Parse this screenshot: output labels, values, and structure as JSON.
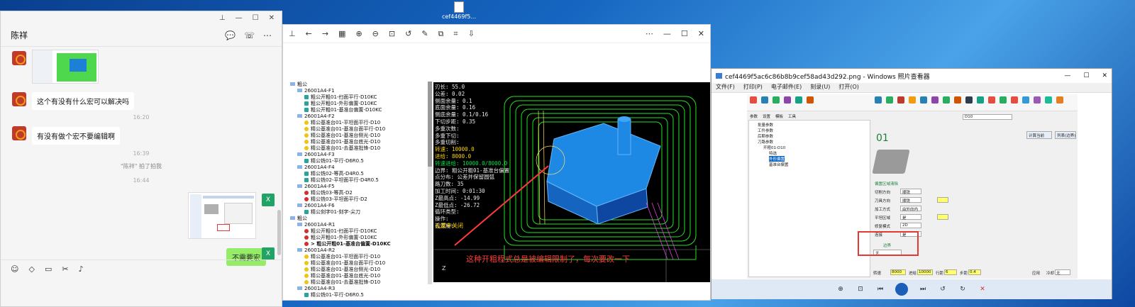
{
  "desktop": {
    "file_label": "cef4469f5..."
  },
  "chat": {
    "contact_name": "陈祥",
    "messages": [
      {
        "text": "这个有没有什么宏可以解决吗"
      },
      {
        "text": "有没有做个宏不要编辑啊"
      }
    ],
    "times": [
      "16:20",
      "16:39",
      "16:44"
    ],
    "system_note": "\"陈祥\" 拍了拍我",
    "reply": "不需要宏"
  },
  "viewer": {
    "tree": [
      {
        "text": "粗公",
        "lvl": 0,
        "kind": "fold"
      },
      {
        "text": "26001A4-F1",
        "lvl": 1,
        "kind": "fold"
      },
      {
        "text": "粗公开粗01-扫面平行-D10KC",
        "lvl": 2,
        "kind": "g"
      },
      {
        "text": "粗公开粗01-外形偏置-D10KC",
        "lvl": 2,
        "kind": "g"
      },
      {
        "text": "粗公开粗01-基准台偏置-D10KC",
        "lvl": 2,
        "kind": "g"
      },
      {
        "text": "26001A4-F2",
        "lvl": 1,
        "kind": "fold"
      },
      {
        "text": "精公基准台01-平坦面平行-D10",
        "lvl": 2,
        "kind": "y"
      },
      {
        "text": "精公基准台01-基准台面平行-D10",
        "lvl": 2,
        "kind": "y"
      },
      {
        "text": "精公基准台01-基准台侧光-D10",
        "lvl": 2,
        "kind": "y"
      },
      {
        "text": "精公基准台01-基准台底光-D10",
        "lvl": 2,
        "kind": "y"
      },
      {
        "text": "精公基准台01-去基准批锋-D10",
        "lvl": 2,
        "kind": "y"
      },
      {
        "text": "26001A4-F3",
        "lvl": 1,
        "kind": "fold"
      },
      {
        "text": "精公铣01-平行-D6R0.5",
        "lvl": 2,
        "kind": "g"
      },
      {
        "text": "26001A4-F4",
        "lvl": 1,
        "kind": "fold"
      },
      {
        "text": "精公铣02-等高-D4R0.5",
        "lvl": 2,
        "kind": "g"
      },
      {
        "text": "精公铣02-平坦面平行-D4R0.5",
        "lvl": 2,
        "kind": "g"
      },
      {
        "text": "26001A4-F5",
        "lvl": 1,
        "kind": "fold"
      },
      {
        "text": "精公铣03-等高-D2",
        "lvl": 2,
        "kind": "r"
      },
      {
        "text": "精公铣03-平坦面平行-D2",
        "lvl": 2,
        "kind": "r"
      },
      {
        "text": "26001A4-F6",
        "lvl": 1,
        "kind": "fold"
      },
      {
        "text": "精公刻字01-刻字-尖刀",
        "lvl": 2,
        "kind": "g"
      },
      {
        "text": "粗公",
        "lvl": 0,
        "kind": "fold"
      },
      {
        "text": "26001A4-R1",
        "lvl": 1,
        "kind": "fold"
      },
      {
        "text": "粗公开粗01-扫面平行-D10KC",
        "lvl": 2,
        "kind": "r"
      },
      {
        "text": "粗公开粗01-外形偏置-D10KC",
        "lvl": 2,
        "kind": "r"
      },
      {
        "text": "> 粗公开粗01-基准台偏置-D10KC",
        "lvl": 2,
        "kind": "r",
        "bold": true
      },
      {
        "text": "26001A4-R2",
        "lvl": 1,
        "kind": "fold"
      },
      {
        "text": "精公基准台01-平坦面平行-D10",
        "lvl": 2,
        "kind": "y"
      },
      {
        "text": "精公基准台01-基准台面平行-D10",
        "lvl": 2,
        "kind": "y"
      },
      {
        "text": "精公基准台01-基准台侧光-D10",
        "lvl": 2,
        "kind": "y"
      },
      {
        "text": "精公基准台01-基准台底光-D10",
        "lvl": 2,
        "kind": "y"
      },
      {
        "text": "精公基准台01-去基准批锋-D10",
        "lvl": 2,
        "kind": "y"
      },
      {
        "text": "26001A4-R3",
        "lvl": 1,
        "kind": "fold"
      },
      {
        "text": "精公铣01-平行-D6R0.5",
        "lvl": 2,
        "kind": "g"
      }
    ],
    "cad_params": [
      "刃长: 55.0",
      "公差: 0.02",
      "侧面余量: 0.1",
      "底面余量: 0.16",
      "侧底余量: 0.1/0.16",
      "下切步距: 0.35",
      "多重次数:",
      "多重下切:",
      "多重切削:"
    ],
    "cad_params2": [
      "转速: 10000.0",
      "进给: 8000.0",
      "转速进给: 10000.0/8000.0"
    ],
    "cad_params3": [
      "边界: 粗公开粗01-基准台偏置",
      "点分布: 公差并保留圆弧",
      "路刀数: 35",
      "加工时间: 0:01:30",
      "Z最高点: -14.99",
      "Z最低点: -26.72",
      "循环类型:",
      "操作:",
      "孔深度:"
    ],
    "cad_off": "设置中关闭",
    "note": "这种开粗程式总是被编辑限制了，每次要改一下",
    "axis_label": "Z"
  },
  "wpv": {
    "title": "cef4469f5ac6c86b8b9cef58ad43d292.png - Windows 照片查看器",
    "menu": [
      "文件(F)",
      "打印(P)",
      "电子邮件(E)",
      "刻录(U)",
      "打开(O)"
    ],
    "inner_tree": [
      "批量参数",
      "工件参数",
      "后期参数",
      "刀路参数",
      "开粗01-D10",
      "特选",
      "外形偏置",
      "基准台偏置"
    ],
    "inner_tabs": [
      "参数",
      "设置",
      "模板",
      "工具"
    ],
    "tool_name": "D10",
    "label_01": "01",
    "calc_btn": "计算当前",
    "list_btn": "列表(边界)",
    "section": "偏置区域清除",
    "options": [
      "切削方向",
      "刀具方向",
      "加工方式",
      "平坦区域",
      "修复模式",
      "连接"
    ],
    "values": [
      "顺铣",
      "顺铣",
      "由外向内",
      "是",
      "2D",
      "是"
    ],
    "speed_label": "转速",
    "speed": "8000",
    "feed_label": "进给",
    "feed": "10000",
    "stepover_label": "行距",
    "stepover": "6",
    "stepdown_label": "步距",
    "stepdown": "0.4",
    "apply": "应用",
    "cooling": "冷却",
    "cool_val": "无",
    "boundary": "边界",
    "none": "无"
  }
}
